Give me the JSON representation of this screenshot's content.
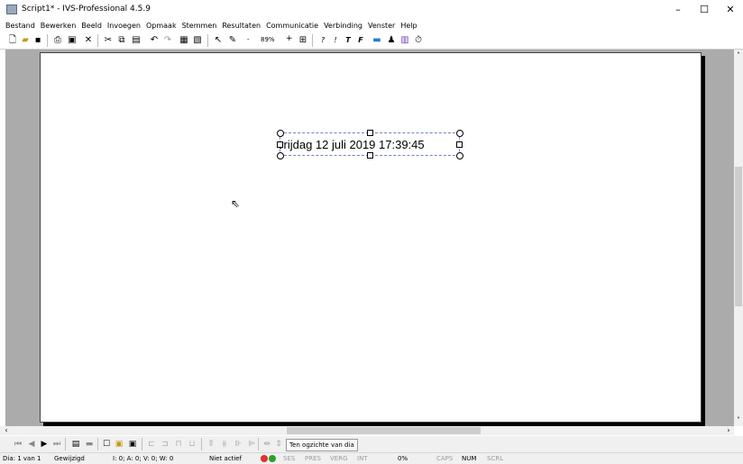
{
  "window": {
    "title": "Script1* - IVS-Professional 4.5.9",
    "minimize": "–",
    "maximize": "☐",
    "close": "✕"
  },
  "menu": [
    "Bestand",
    "Bewerken",
    "Beeld",
    "Invoegen",
    "Opmaak",
    "Stemmen",
    "Resultaten",
    "Communicatie",
    "Verbinding",
    "Venster",
    "Help"
  ],
  "toolbar": {
    "zoom_minus": "-",
    "zoom": "89%",
    "zoom_plus": "+",
    "text_q": "?",
    "text_i": "!",
    "text_t": "T",
    "text_f": "F"
  },
  "slide": {
    "text": "vrijdag 12 juli 2019 17:39:45"
  },
  "navbar": {
    "overview_button": "Ten ogzichte van dia"
  },
  "status": {
    "slide": "Dia: 1 van 1",
    "state": "Gewijzigd",
    "counters": "I: 0;  A: 0;  V: 0;  W: 0",
    "mode": "Niet actief",
    "ses": "SES",
    "pres": "PRES",
    "verg": "VERG",
    "int": "INT",
    "percent": "0%",
    "caps": "CAPS",
    "num": "NUM",
    "scrl": "SCRL"
  },
  "colors": {
    "workspace": "#ababab",
    "selection": "#6d7fd0",
    "status_red": "#e03030",
    "status_green": "#2ca02c"
  }
}
